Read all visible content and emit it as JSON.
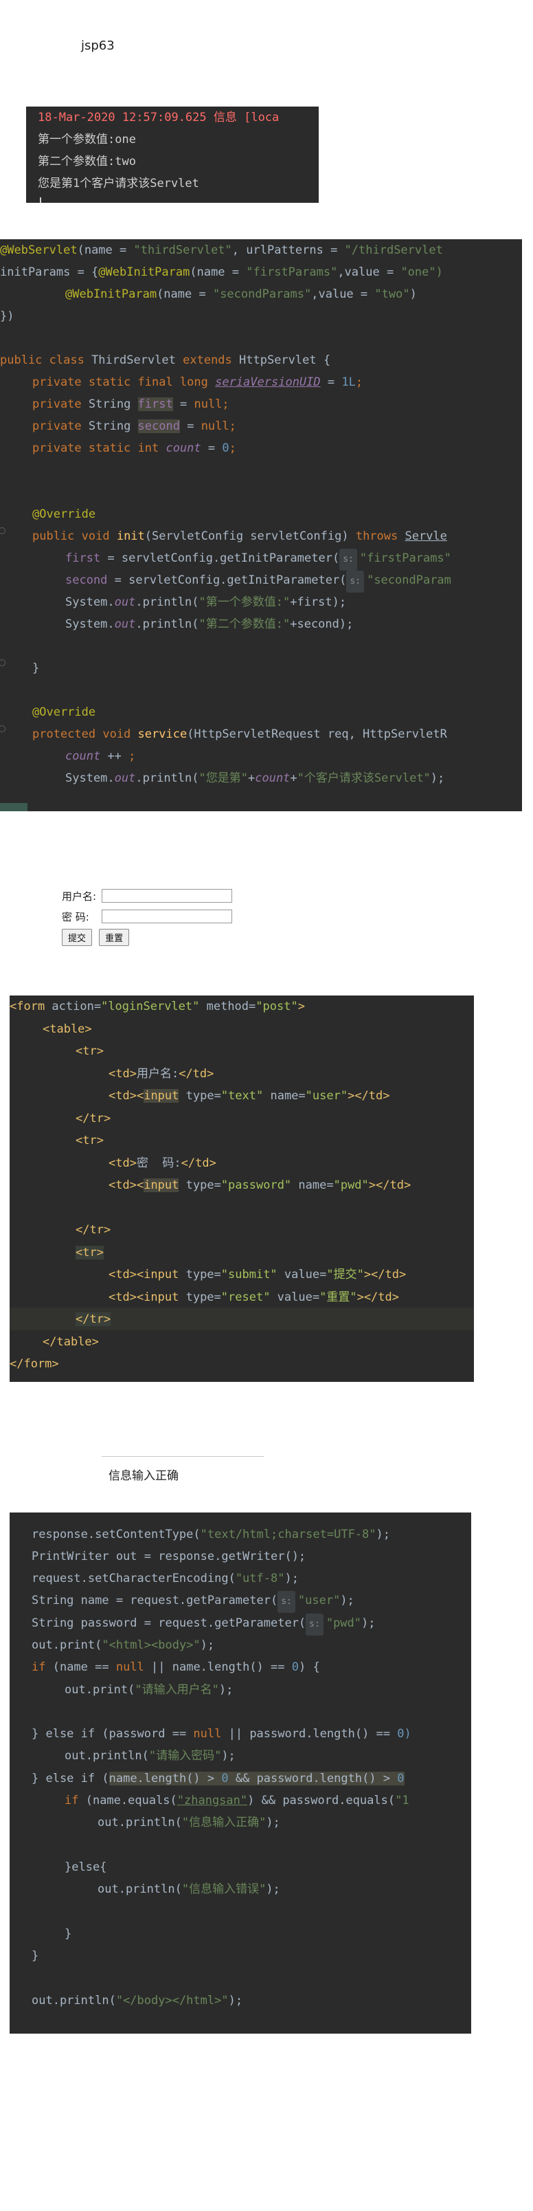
{
  "page_title": "jsp63",
  "console": {
    "lines": [
      "18-Mar-2020 12:57:09.625 信息 [loca",
      "第一个参数值:one",
      "第二个参数值:two",
      "您是第1个客户请求该Servlet"
    ]
  },
  "code1": {
    "l1": "@WebServlet",
    "l1_args": "(name = ",
    "l1_name": "\"thirdServlet\"",
    "l1_url": ", urlPatterns = ",
    "l1_urlv": "\"/thirdServlet",
    "l2": "initParams = {",
    "l2_ann": "@WebInitParam",
    "l2_a": "(name = ",
    "l2_n": "\"firstParams\"",
    "l2_v": ",value = ",
    "l2_vv": "\"one\")",
    "l3_ann": "@WebInitParam",
    "l3_a": "(name = ",
    "l3_n": "\"secondParams\"",
    "l3_v": ",value = ",
    "l3_vv": "\"two\"",
    "l3_end": ")",
    "l4": "})",
    "class_kw": "public class ",
    "class_name": "ThirdServlet ",
    "extends_kw": "extends ",
    "class_parent": "HttpServlet {",
    "f1_kw": "private static final long ",
    "f1_name": "seriaVersionUID",
    "f1_rest": " = ",
    "f1_val": "1L",
    "semi": ";",
    "f2_kw": "private ",
    "f2_type": "String ",
    "f2_name": "first",
    "f2_rest": " = ",
    "null": "null",
    "f3_name": "second",
    "f4_kw": "private static int ",
    "f4_name": "count",
    "f4_val": "0",
    "override": "@Override",
    "init_kw": "public void ",
    "init_name": "init",
    "init_args": "(ServletConfig servletConfig) ",
    "throws": "throws ",
    "init_exc": "Servle",
    "i1_a": "first",
    "i1_b": " = servletConfig.getInitParameter(",
    "hint_s": "s:",
    "i1_s": "\"firstParams\"",
    "i2_a": "second",
    "i2_s": "\"secondParam",
    "sys": "System.",
    "out": "out",
    "println": ".println(",
    "p1_s": "\"第一个参数值:\"",
    "p1_rest": "+first);",
    "p2_s": "\"第二个参数值:\"",
    "p2_rest": "+second);",
    "close": "}",
    "svc_kw": "protected void ",
    "svc_name": "service",
    "svc_args": "(HttpServletRequest req, HttpServletR",
    "cnt": "count",
    "cnt_rest": " ++ ",
    "p3_s1": "\"您是第\"",
    "p3_plus": "+",
    "p3_s2": "\"个客户请求该Servlet\"",
    "p3_end": ");"
  },
  "login_form": {
    "user_label": "用户名:",
    "pwd_label": "密 码:",
    "submit": "提交",
    "reset": "重置"
  },
  "code2": {
    "form_open": "<form ",
    "attr_action": "action=",
    "val_action": "\"loginServlet\"",
    "attr_method": " method=",
    "val_method": "\"post\"",
    "gt": ">",
    "table_open": "<table>",
    "tr_open": "<tr>",
    "tr_close": "</tr>",
    "td_open": "<td>",
    "td_close": "</td>",
    "user_text": "用户名:",
    "pwd_text": "密  码:",
    "input_lt": "<",
    "input": "input",
    "attr_type": " type=",
    "val_text": "\"text\"",
    "attr_name": " name=",
    "val_user": "\"user\"",
    "end_tag": "></td>",
    "val_password": "\"password\"",
    "val_pwd": "\"pwd\"",
    "td_input": "<td><input",
    "val_submit": "\"submit\"",
    "attr_value": " value=",
    "val_tijiao": "\"提交\"",
    "val_reset": "\"reset\"",
    "val_chongzhi": "\"重置\"",
    "table_close": "</table>",
    "form_close": "</form>"
  },
  "result": {
    "text": "信息输入正确"
  },
  "code3": {
    "c1a": "response.setContentType(",
    "c1s": "\"text/html;charset=UTF-8\"",
    "c1e": ");",
    "c2a": "PrintWriter out = response.getWriter();",
    "c3a": "request.setCharacterEncoding(",
    "c3s": "\"utf-8\"",
    "c4a": "String name = request.getParameter(",
    "c4s": "\"user\"",
    "c5a": "String password = request.getParameter(",
    "c5s": "\"pwd\"",
    "c6a": "out.print(",
    "c6s": "\"<html><body>\"",
    "if_kw": "if ",
    "c7a": "(name == ",
    "c7b": " || name.length() == ",
    "zero": "0",
    "c7c": ") {",
    "c8s": "\"请输入用户名\"",
    "else_if": "} else if ",
    "c9a": "(password == ",
    "c9b": " || password.length() == ",
    "c9c": "0)",
    "c10a": "out.println(",
    "c10s": "\"请输入密码\"",
    "c11a": "(",
    "c11b": "name.length() > ",
    "c11c": " && password.length() > ",
    "c11d": "0",
    "c12a": "(name.equals(",
    "c12s": "\"zhangsan\"",
    "c12b": ") && password.equals(",
    "c12c": "\"1",
    "c13s": "\"信息输入正确\"",
    "else": "}else{",
    "c14s": "\"信息输入错误\"",
    "c15s": "\"</body></html>\""
  }
}
